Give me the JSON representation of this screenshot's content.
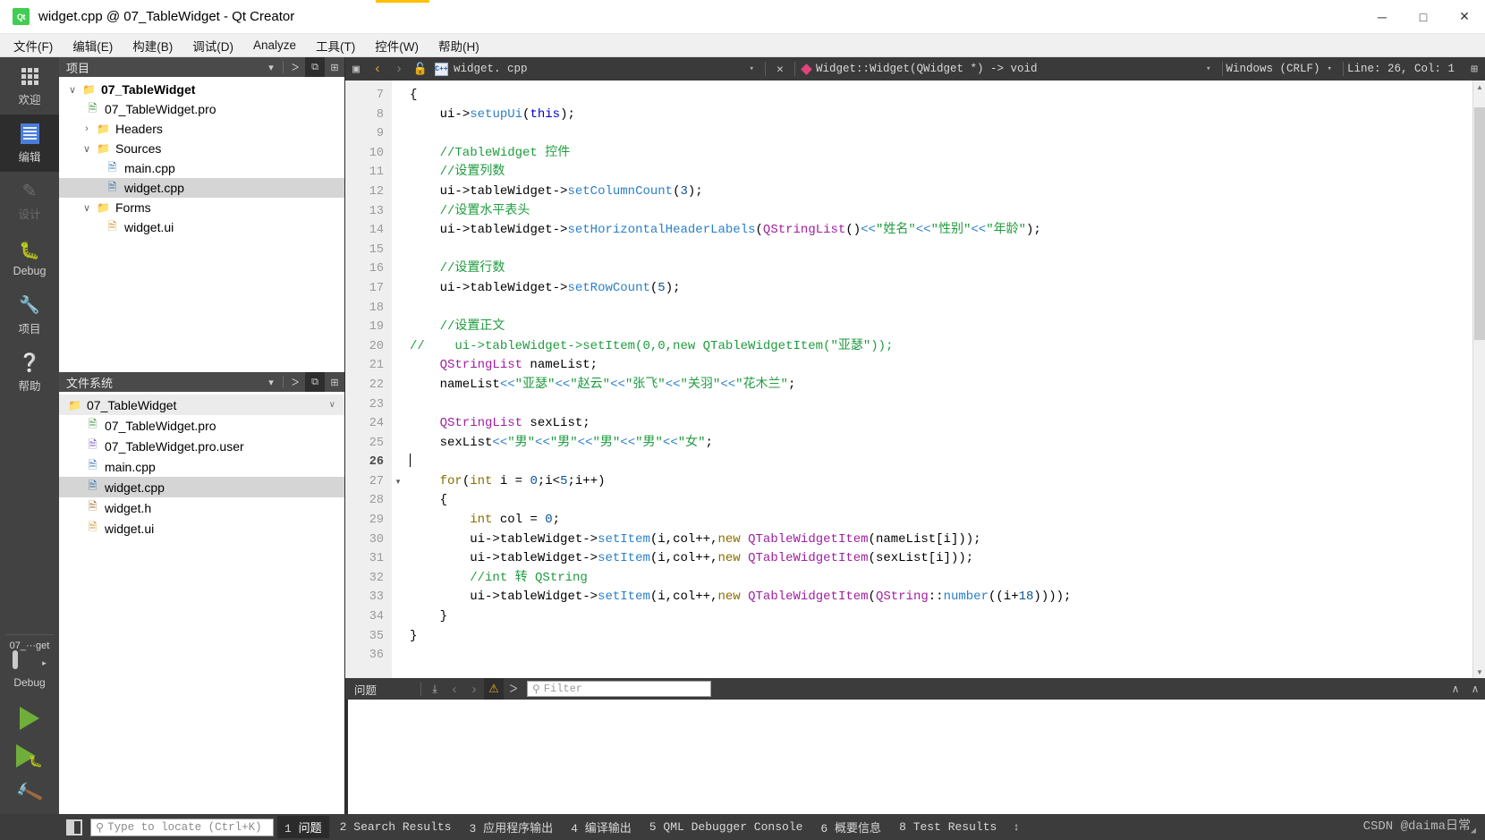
{
  "window": {
    "title": "widget.cpp @ 07_TableWidget - Qt Creator",
    "logo_text": "Qt",
    "minimize": "─",
    "maximize": "□",
    "close": "✕"
  },
  "menubar": {
    "items": [
      {
        "label": "文件(F)",
        "name": "menu-file"
      },
      {
        "label": "编辑(E)",
        "name": "menu-edit"
      },
      {
        "label": "构建(B)",
        "name": "menu-build"
      },
      {
        "label": "调试(D)",
        "name": "menu-debug"
      },
      {
        "label": "Analyze",
        "name": "menu-analyze"
      },
      {
        "label": "工具(T)",
        "name": "menu-tools"
      },
      {
        "label": "控件(W)",
        "name": "menu-window"
      },
      {
        "label": "帮助(H)",
        "name": "menu-help"
      }
    ]
  },
  "modebar": {
    "modes": [
      {
        "label": "欢迎",
        "icon": "grid-icon",
        "state": "normal"
      },
      {
        "label": "编辑",
        "icon": "document-icon",
        "state": "active"
      },
      {
        "label": "设计",
        "icon": "pencil-icon",
        "state": "disabled"
      },
      {
        "label": "Debug",
        "icon": "bug-icon",
        "state": "normal"
      },
      {
        "label": "项目",
        "icon": "wrench-icon",
        "state": "normal"
      },
      {
        "label": "帮助",
        "icon": "question-icon",
        "state": "normal"
      }
    ],
    "kit": {
      "project": "07_···get",
      "build_config": "Debug",
      "arrow": "▸"
    },
    "actions": {
      "run": "run-button",
      "debug": "start-debugging-button",
      "build": "build-button"
    }
  },
  "project_dock": {
    "title": "项目",
    "buttons": {
      "dropdown": "▾",
      "filter": "ᐳ",
      "link": "⧉",
      "split": "⊞"
    },
    "tree": [
      {
        "label": "07_TableWidget",
        "indent": 0,
        "arrow": "∨",
        "icon": "qt-project-icon",
        "bold": true,
        "selected": false
      },
      {
        "label": "07_TableWidget.pro",
        "indent": 1,
        "arrow": "",
        "icon": "pro-file-icon",
        "bold": false,
        "selected": false
      },
      {
        "label": "Headers",
        "indent": 1,
        "arrow": "›",
        "icon": "folder-h-icon",
        "bold": false,
        "selected": false
      },
      {
        "label": "Sources",
        "indent": 1,
        "arrow": "∨",
        "icon": "folder-cpp-icon",
        "bold": false,
        "selected": false
      },
      {
        "label": "main.cpp",
        "indent": 2,
        "arrow": "",
        "icon": "cpp-file-icon",
        "bold": false,
        "selected": false
      },
      {
        "label": "widget.cpp",
        "indent": 2,
        "arrow": "",
        "icon": "cpp-file-icon",
        "bold": false,
        "selected": true
      },
      {
        "label": "Forms",
        "indent": 1,
        "arrow": "∨",
        "icon": "folder-ui-icon",
        "bold": false,
        "selected": false
      },
      {
        "label": "widget.ui",
        "indent": 2,
        "arrow": "",
        "icon": "ui-file-icon",
        "bold": false,
        "selected": false
      }
    ]
  },
  "filesystem_dock": {
    "title": "文件系统",
    "root": "07_TableWidget",
    "root_chevron": "∨",
    "items": [
      {
        "label": "07_TableWidget.pro",
        "icon": "pro-file-icon",
        "selected": false
      },
      {
        "label": "07_TableWidget.pro.user",
        "icon": "user-file-icon",
        "selected": false
      },
      {
        "label": "main.cpp",
        "icon": "cpp-file-icon",
        "selected": false
      },
      {
        "label": "widget.cpp",
        "icon": "cpp-file-icon",
        "selected": true
      },
      {
        "label": "widget.h",
        "icon": "h-file-icon",
        "selected": false
      },
      {
        "label": "widget.ui",
        "icon": "ui-file-icon",
        "selected": false
      }
    ]
  },
  "editor_toolbar": {
    "split_icon": "▣",
    "back": "‹",
    "forward": "›",
    "lock_icon": "🔓",
    "filename": "widget. cpp",
    "file_dropdown": "▾",
    "close": "✕",
    "symbol": "Widget::Widget(QWidget *) -> void",
    "symbol_dropdown": "▾",
    "line_ending": "Windows  (CRLF)",
    "line_ending_dropdown": "▾",
    "cursor_position": "Line: 26, Col: 1",
    "extra_icon": "⊞"
  },
  "code": {
    "first_line": 7,
    "cursor_line": 26,
    "lines": [
      {
        "n": 7,
        "fold": "",
        "tokens": [
          {
            "t": "{",
            "c": "id"
          }
        ]
      },
      {
        "n": 8,
        "fold": "",
        "tokens": [
          {
            "t": "    ui",
            "c": "id"
          },
          {
            "t": "->",
            "c": "id"
          },
          {
            "t": "setupUi",
            "c": "fn"
          },
          {
            "t": "(",
            "c": "id"
          },
          {
            "t": "this",
            "c": "kw2"
          },
          {
            "t": ");",
            "c": "id"
          }
        ]
      },
      {
        "n": 9,
        "fold": "",
        "tokens": []
      },
      {
        "n": 10,
        "fold": "",
        "tokens": [
          {
            "t": "    //TableWidget 控件",
            "c": "cm"
          }
        ]
      },
      {
        "n": 11,
        "fold": "",
        "tokens": [
          {
            "t": "    //设置列数",
            "c": "cm"
          }
        ]
      },
      {
        "n": 12,
        "fold": "",
        "tokens": [
          {
            "t": "    ui",
            "c": "id"
          },
          {
            "t": "->",
            "c": "id"
          },
          {
            "t": "tableWidget",
            "c": "id"
          },
          {
            "t": "->",
            "c": "id"
          },
          {
            "t": "setColumnCount",
            "c": "fn"
          },
          {
            "t": "(",
            "c": "id"
          },
          {
            "t": "3",
            "c": "num"
          },
          {
            "t": ");",
            "c": "id"
          }
        ]
      },
      {
        "n": 13,
        "fold": "",
        "tokens": [
          {
            "t": "    //设置水平表头",
            "c": "cm"
          }
        ]
      },
      {
        "n": 14,
        "fold": "",
        "tokens": [
          {
            "t": "    ui",
            "c": "id"
          },
          {
            "t": "->",
            "c": "id"
          },
          {
            "t": "tableWidget",
            "c": "id"
          },
          {
            "t": "->",
            "c": "id"
          },
          {
            "t": "setHorizontalHeaderLabels",
            "c": "fn"
          },
          {
            "t": "(",
            "c": "id"
          },
          {
            "t": "QStringList",
            "c": "typ"
          },
          {
            "t": "()",
            "c": "id"
          },
          {
            "t": "<<",
            "c": "fn"
          },
          {
            "t": "\"姓名\"",
            "c": "str"
          },
          {
            "t": "<<",
            "c": "fn"
          },
          {
            "t": "\"性别\"",
            "c": "str"
          },
          {
            "t": "<<",
            "c": "fn"
          },
          {
            "t": "\"年龄\"",
            "c": "str"
          },
          {
            "t": ");",
            "c": "id"
          }
        ]
      },
      {
        "n": 15,
        "fold": "",
        "tokens": []
      },
      {
        "n": 16,
        "fold": "",
        "tokens": [
          {
            "t": "    //设置行数",
            "c": "cm"
          }
        ]
      },
      {
        "n": 17,
        "fold": "",
        "tokens": [
          {
            "t": "    ui",
            "c": "id"
          },
          {
            "t": "->",
            "c": "id"
          },
          {
            "t": "tableWidget",
            "c": "id"
          },
          {
            "t": "->",
            "c": "id"
          },
          {
            "t": "setRowCount",
            "c": "fn"
          },
          {
            "t": "(",
            "c": "id"
          },
          {
            "t": "5",
            "c": "num"
          },
          {
            "t": ");",
            "c": "id"
          }
        ]
      },
      {
        "n": 18,
        "fold": "",
        "tokens": []
      },
      {
        "n": 19,
        "fold": "",
        "tokens": [
          {
            "t": "    //设置正文",
            "c": "cm"
          }
        ]
      },
      {
        "n": 20,
        "fold": "",
        "tokens": [
          {
            "t": "//    ui->tableWidget->setItem(0,0,new QTableWidgetItem(\"亚瑟\"));",
            "c": "cm"
          }
        ]
      },
      {
        "n": 21,
        "fold": "",
        "tokens": [
          {
            "t": "    QStringList",
            "c": "typ"
          },
          {
            "t": " nameList",
            "c": "id"
          },
          {
            "t": ";",
            "c": "id"
          }
        ]
      },
      {
        "n": 22,
        "fold": "",
        "tokens": [
          {
            "t": "    nameList",
            "c": "id"
          },
          {
            "t": "<<",
            "c": "fn"
          },
          {
            "t": "\"亚瑟\"",
            "c": "str"
          },
          {
            "t": "<<",
            "c": "fn"
          },
          {
            "t": "\"赵云\"",
            "c": "str"
          },
          {
            "t": "<<",
            "c": "fn"
          },
          {
            "t": "\"张飞\"",
            "c": "str"
          },
          {
            "t": "<<",
            "c": "fn"
          },
          {
            "t": "\"关羽\"",
            "c": "str"
          },
          {
            "t": "<<",
            "c": "fn"
          },
          {
            "t": "\"花木兰\"",
            "c": "str"
          },
          {
            "t": ";",
            "c": "id"
          }
        ]
      },
      {
        "n": 23,
        "fold": "",
        "tokens": []
      },
      {
        "n": 24,
        "fold": "",
        "tokens": [
          {
            "t": "    QStringList",
            "c": "typ"
          },
          {
            "t": " sexList",
            "c": "id"
          },
          {
            "t": ";",
            "c": "id"
          }
        ]
      },
      {
        "n": 25,
        "fold": "",
        "tokens": [
          {
            "t": "    sexList",
            "c": "id"
          },
          {
            "t": "<<",
            "c": "fn"
          },
          {
            "t": "\"男\"",
            "c": "str"
          },
          {
            "t": "<<",
            "c": "fn"
          },
          {
            "t": "\"男\"",
            "c": "str"
          },
          {
            "t": "<<",
            "c": "fn"
          },
          {
            "t": "\"男\"",
            "c": "str"
          },
          {
            "t": "<<",
            "c": "fn"
          },
          {
            "t": "\"男\"",
            "c": "str"
          },
          {
            "t": "<<",
            "c": "fn"
          },
          {
            "t": "\"女\"",
            "c": "str"
          },
          {
            "t": ";",
            "c": "id"
          }
        ]
      },
      {
        "n": 26,
        "fold": "",
        "tokens": [],
        "cursor": true
      },
      {
        "n": 27,
        "fold": "▾",
        "tokens": [
          {
            "t": "    for",
            "c": "kw"
          },
          {
            "t": "(",
            "c": "id"
          },
          {
            "t": "int",
            "c": "kw"
          },
          {
            "t": " i = ",
            "c": "id"
          },
          {
            "t": "0",
            "c": "num"
          },
          {
            "t": ";i<",
            "c": "id"
          },
          {
            "t": "5",
            "c": "num"
          },
          {
            "t": ";i++)",
            "c": "id"
          }
        ]
      },
      {
        "n": 28,
        "fold": "",
        "tokens": [
          {
            "t": "    {",
            "c": "id"
          }
        ]
      },
      {
        "n": 29,
        "fold": "",
        "tokens": [
          {
            "t": "        int",
            "c": "kw"
          },
          {
            "t": " col = ",
            "c": "id"
          },
          {
            "t": "0",
            "c": "num"
          },
          {
            "t": ";",
            "c": "id"
          }
        ]
      },
      {
        "n": 30,
        "fold": "",
        "tokens": [
          {
            "t": "        ui",
            "c": "id"
          },
          {
            "t": "->",
            "c": "id"
          },
          {
            "t": "tableWidget",
            "c": "id"
          },
          {
            "t": "->",
            "c": "id"
          },
          {
            "t": "setItem",
            "c": "fn"
          },
          {
            "t": "(i,col++,",
            "c": "id"
          },
          {
            "t": "new",
            "c": "kw"
          },
          {
            "t": " ",
            "c": "id"
          },
          {
            "t": "QTableWidgetItem",
            "c": "typ"
          },
          {
            "t": "(nameList[i]));",
            "c": "id"
          }
        ]
      },
      {
        "n": 31,
        "fold": "",
        "tokens": [
          {
            "t": "        ui",
            "c": "id"
          },
          {
            "t": "->",
            "c": "id"
          },
          {
            "t": "tableWidget",
            "c": "id"
          },
          {
            "t": "->",
            "c": "id"
          },
          {
            "t": "setItem",
            "c": "fn"
          },
          {
            "t": "(i,col++,",
            "c": "id"
          },
          {
            "t": "new",
            "c": "kw"
          },
          {
            "t": " ",
            "c": "id"
          },
          {
            "t": "QTableWidgetItem",
            "c": "typ"
          },
          {
            "t": "(sexList[i]));",
            "c": "id"
          }
        ]
      },
      {
        "n": 32,
        "fold": "",
        "tokens": [
          {
            "t": "        //int 转 QString",
            "c": "cm"
          }
        ]
      },
      {
        "n": 33,
        "fold": "",
        "tokens": [
          {
            "t": "        ui",
            "c": "id"
          },
          {
            "t": "->",
            "c": "id"
          },
          {
            "t": "tableWidget",
            "c": "id"
          },
          {
            "t": "->",
            "c": "id"
          },
          {
            "t": "setItem",
            "c": "fn"
          },
          {
            "t": "(i,col++,",
            "c": "id"
          },
          {
            "t": "new",
            "c": "kw"
          },
          {
            "t": " ",
            "c": "id"
          },
          {
            "t": "QTableWidgetItem",
            "c": "typ"
          },
          {
            "t": "(",
            "c": "id"
          },
          {
            "t": "QString",
            "c": "typ"
          },
          {
            "t": "::",
            "c": "id"
          },
          {
            "t": "number",
            "c": "fn"
          },
          {
            "t": "((i+",
            "c": "id"
          },
          {
            "t": "18",
            "c": "num"
          },
          {
            "t": "))));",
            "c": "id"
          }
        ]
      },
      {
        "n": 34,
        "fold": "",
        "tokens": [
          {
            "t": "    }",
            "c": "id"
          }
        ]
      },
      {
        "n": 35,
        "fold": "",
        "tokens": [
          {
            "t": "}",
            "c": "id"
          }
        ]
      },
      {
        "n": 36,
        "fold": "",
        "tokens": []
      }
    ]
  },
  "output_pane": {
    "title": "问题",
    "icons": {
      "categorize": "⤓",
      "prev": "‹",
      "next": "›",
      "warning": "⚠",
      "filter": "ᐳ"
    },
    "filter_placeholder": "Filter",
    "search_icon": "⚲",
    "collapse": "∧",
    "maximize": "∧"
  },
  "statusbar": {
    "sidebar_toggle": "sidebar-toggle-icon",
    "locate_placeholder": "Type to locate (Ctrl+K)",
    "search_icon": "⚲",
    "tabs": [
      {
        "num": "1",
        "label": "问题",
        "active": true
      },
      {
        "num": "2",
        "label": "Search Results",
        "active": false
      },
      {
        "num": "3",
        "label": "应用程序输出",
        "active": false
      },
      {
        "num": "4",
        "label": "编译输出",
        "active": false
      },
      {
        "num": "5",
        "label": "QML Debugger Console",
        "active": false
      },
      {
        "num": "6",
        "label": "概要信息",
        "active": false
      },
      {
        "num": "8",
        "label": "Test Results",
        "active": false
      }
    ],
    "updown": "↕",
    "watermark": "CSDN @daima日常",
    "resize_grip": "◢"
  }
}
